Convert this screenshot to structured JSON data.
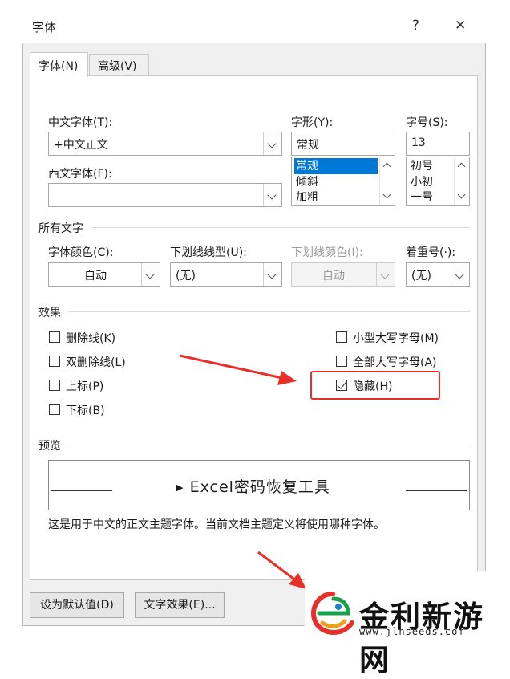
{
  "dialog": {
    "title": "字体",
    "help_glyph": "?",
    "close_glyph": "✕"
  },
  "tabs": [
    {
      "label": "字体(N)"
    },
    {
      "label": "高级(V)"
    }
  ],
  "font": {
    "cn_font_label": "中文字体(T):",
    "cn_font_value": "+中文正文",
    "west_font_label": "西文字体(F):",
    "west_font_value": "",
    "style_label": "字形(Y):",
    "style_value": "常规",
    "style_options": [
      "常规",
      "倾斜",
      "加粗"
    ],
    "style_selected": "常规",
    "size_label": "字号(S):",
    "size_value": "13",
    "size_options": [
      "初号",
      "小初",
      "一号"
    ]
  },
  "all_text": {
    "section": "所有文字",
    "color_label": "字体颜色(C):",
    "color_value": "自动",
    "underline_label": "下划线线型(U):",
    "underline_value": "(无)",
    "underline_color_label": "下划线颜色(I):",
    "underline_color_value": "自动",
    "emphasis_label": "着重号(·):",
    "emphasis_value": "(无)"
  },
  "effects": {
    "section": "效果",
    "strikethrough": {
      "label": "删除线(K)",
      "checked": false
    },
    "double_strikethrough": {
      "label": "双删除线(L)",
      "checked": false
    },
    "superscript": {
      "label": "上标(P)",
      "checked": false
    },
    "subscript": {
      "label": "下标(B)",
      "checked": false
    },
    "small_caps": {
      "label": "小型大写字母(M)",
      "checked": false
    },
    "all_caps": {
      "label": "全部大写字母(A)",
      "checked": false
    },
    "hidden": {
      "label": "隐藏(H)",
      "checked": true
    }
  },
  "preview": {
    "section": "预览",
    "sample": "▸ Excel密码恢复工具",
    "note": "这是用于中文的正文主题字体。当前文档主题定义将使用哪种字体。"
  },
  "buttons": {
    "set_default": "设为默认值(D)",
    "text_effects": "文字效果(E)..."
  },
  "watermark": {
    "brand": "金利新游网",
    "url": "www.jlnseeds.com"
  },
  "colors": {
    "accent": "#0078d7",
    "annotation_red": "#e8302a"
  }
}
